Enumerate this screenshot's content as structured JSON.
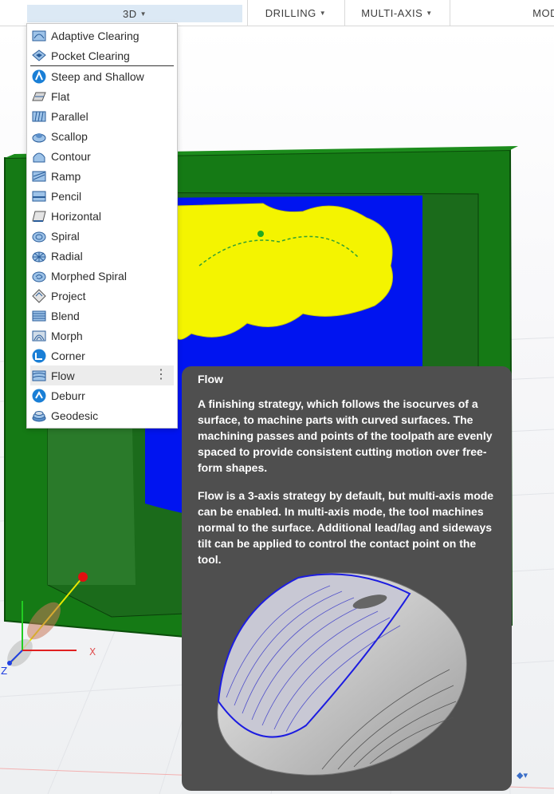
{
  "toolbar": {
    "tabs": [
      {
        "label": "3D"
      },
      {
        "label": "DRILLING"
      },
      {
        "label": "MULTI-AXIS"
      },
      {
        "label": "MOD"
      }
    ]
  },
  "menu": {
    "items": [
      {
        "label": "Adaptive Clearing",
        "icon": "adaptive-clearing-icon"
      },
      {
        "label": "Pocket Clearing",
        "icon": "pocket-clearing-icon"
      },
      {
        "label": "Steep and Shallow",
        "icon": "steep-and-shallow-icon"
      },
      {
        "label": "Flat",
        "icon": "flat-icon"
      },
      {
        "label": "Parallel",
        "icon": "parallel-icon"
      },
      {
        "label": "Scallop",
        "icon": "scallop-icon"
      },
      {
        "label": "Contour",
        "icon": "contour-icon"
      },
      {
        "label": "Ramp",
        "icon": "ramp-icon"
      },
      {
        "label": "Pencil",
        "icon": "pencil-icon"
      },
      {
        "label": "Horizontal",
        "icon": "horizontal-icon"
      },
      {
        "label": "Spiral",
        "icon": "spiral-icon"
      },
      {
        "label": "Radial",
        "icon": "radial-icon"
      },
      {
        "label": "Morphed Spiral",
        "icon": "morphed-spiral-icon"
      },
      {
        "label": "Project",
        "icon": "project-icon"
      },
      {
        "label": "Blend",
        "icon": "blend-icon"
      },
      {
        "label": "Morph",
        "icon": "morph-icon"
      },
      {
        "label": "Corner",
        "icon": "corner-icon"
      },
      {
        "label": "Flow",
        "icon": "flow-icon"
      },
      {
        "label": "Deburr",
        "icon": "deburr-icon"
      },
      {
        "label": "Geodesic",
        "icon": "geodesic-icon"
      }
    ],
    "hovered": "Flow"
  },
  "tooltip": {
    "title": "Flow",
    "paragraph1": "A finishing strategy, which follows the isocurves of a surface, to machine parts with curved surfaces. The machining passes and points of the toolpath are evenly spaced to provide consistent cutting motion over free-form shapes.",
    "paragraph2": "Flow is a 3-axis strategy by default, but multi-axis mode can be enabled. In multi-axis mode, the tool machines normal to the surface. Additional lead/lag and sideways tilt can be applied to control the contact point on the tool."
  },
  "axes": {
    "x": "X",
    "z": "Z"
  },
  "colors": {
    "stock": "#1a7a1a",
    "part_face": "#0014f0",
    "toolpath": "#f4f400",
    "accent_blue": "#1a7fd6",
    "tooltip_bg": "#4f4f4f",
    "menu_hover": "#ececec"
  }
}
